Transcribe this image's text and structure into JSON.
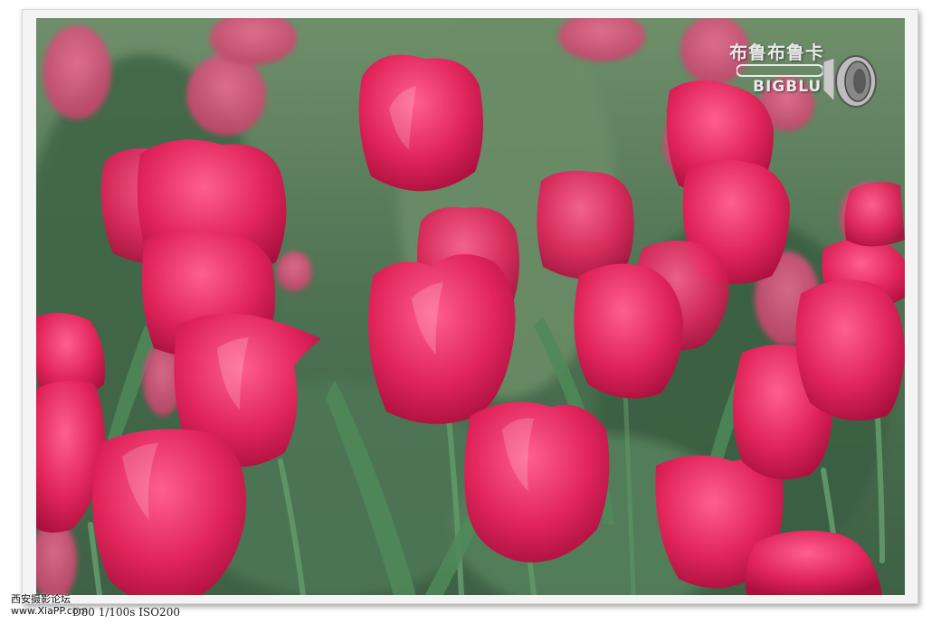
{
  "watermark": {
    "brand_cn": "布鲁布鲁卡",
    "brand_en": "BIGBLU"
  },
  "caption": {
    "exif": "D80 1/100s ISO200"
  },
  "site_stamp": {
    "name": "西安摄影论坛",
    "url": "www.XiaPP.com"
  },
  "colors": {
    "frame": "#f4f4f4",
    "foliage": "#466b4c",
    "tulip_petal": "#e0245a",
    "tulip_highlight": "#f7b7cb"
  },
  "scene": {
    "subject": "pink tulips",
    "icons": [
      "microphone-icon"
    ]
  }
}
